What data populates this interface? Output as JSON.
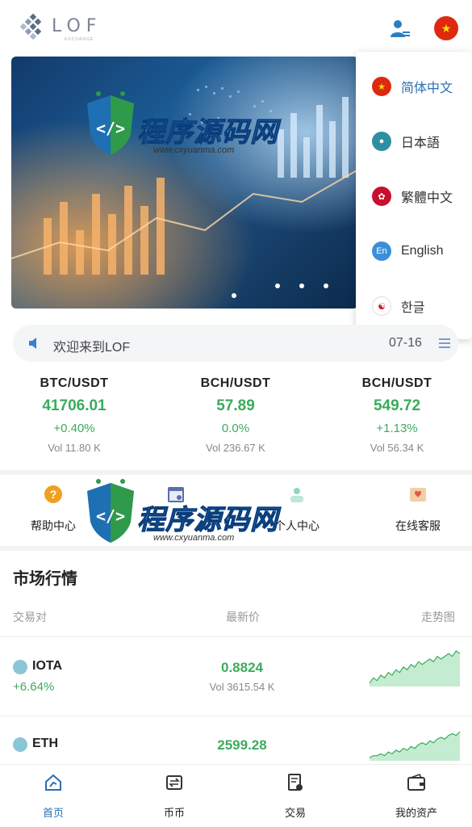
{
  "header": {
    "logo_text": "LOF",
    "logo_sub": "EXCHANGE",
    "icons": [
      "logo-icon",
      "user-icon",
      "flag-china-icon"
    ]
  },
  "language_menu": {
    "items": [
      {
        "label": "简体中文",
        "flag": "flag-china-icon",
        "active": true
      },
      {
        "label": "日本語",
        "flag": "flag-japan-icon",
        "active": false
      },
      {
        "label": "繁體中文",
        "flag": "flag-hongkong-icon",
        "active": false
      },
      {
        "label": "English",
        "flag": "flag-english-icon",
        "badge": "En",
        "active": false
      },
      {
        "label": "한글",
        "flag": "flag-korea-icon",
        "active": false
      }
    ]
  },
  "notice": {
    "text": "欢迎来到LOF",
    "date": "07-16",
    "icons": [
      "speaker-icon",
      "list-icon"
    ]
  },
  "tickers": [
    {
      "pair": "BTC/USDT",
      "price": "41706.01",
      "change": "+0.40%",
      "vol": "Vol 11.80 K"
    },
    {
      "pair": "BCH/USDT",
      "price": "57.89",
      "change": "0.0%",
      "vol": "Vol 236.67 K"
    },
    {
      "pair": "BCH/USDT",
      "price": "549.72",
      "change": "+1.13%",
      "vol": "Vol 56.34 K"
    }
  ],
  "quick_links": [
    {
      "label": "帮助中心",
      "icon": "help-icon"
    },
    {
      "label": "",
      "icon": "calendar-icon"
    },
    {
      "label": "个人中心",
      "icon": "user-center-icon"
    },
    {
      "label": "在线客服",
      "icon": "mail-icon"
    }
  ],
  "market": {
    "title": "市场行情",
    "columns": [
      "交易对",
      "最新价",
      "走势图"
    ],
    "rows": [
      {
        "name": "IOTA",
        "change": "+6.64%",
        "price": "0.8824",
        "vol": "Vol 3615.54 K",
        "trend": [
          10,
          12,
          11,
          13,
          12,
          14,
          13,
          15,
          14,
          16,
          15,
          17,
          16,
          18,
          17,
          18,
          19,
          18,
          20,
          19,
          20,
          21,
          20,
          22,
          21
        ]
      },
      {
        "name": "ETH",
        "change": "",
        "price": "2599.28",
        "vol": "",
        "trend": [
          8,
          9,
          9,
          10,
          9,
          11,
          10,
          12,
          11,
          13,
          12,
          14,
          13,
          15,
          16,
          15,
          17,
          16,
          18,
          19,
          18,
          20,
          21,
          20,
          22
        ]
      }
    ]
  },
  "bottom_nav": [
    {
      "label": "首页",
      "icon": "home-icon",
      "active": true
    },
    {
      "label": "币币",
      "icon": "exchange-icon",
      "active": false
    },
    {
      "label": "交易",
      "icon": "trade-icon",
      "active": false
    },
    {
      "label": "我的资产",
      "icon": "wallet-icon",
      "active": false
    }
  ],
  "watermark": {
    "title": "程序源码网",
    "url": "www.cxyuanma.com"
  },
  "colors": {
    "up_green": "#3bab5d",
    "accent_blue": "#2a6fb5"
  }
}
